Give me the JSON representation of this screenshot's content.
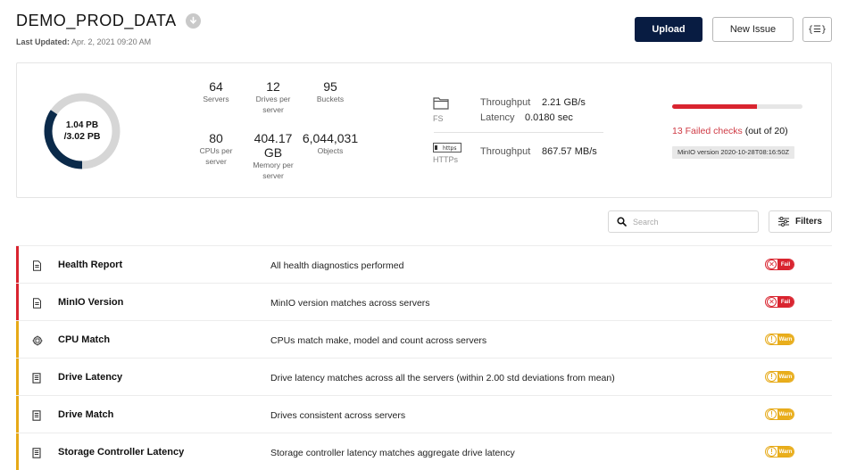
{
  "header": {
    "title": "DEMO_PROD_DATA",
    "last_updated_label": "Last Updated:",
    "last_updated_value": "Apr. 2, 2021 09:20 AM",
    "upload_label": "Upload",
    "new_issue_label": "New Issue",
    "json_label": "{☰}"
  },
  "capacity": {
    "used": "1.04 PB",
    "total": "/3.02 PB",
    "used_fraction": 0.344,
    "used_color": "#0b2a4a",
    "free_color": "#d6d6d6"
  },
  "stats": {
    "servers": {
      "value": "64",
      "label": "Servers"
    },
    "drives_per_server": {
      "value": "12",
      "label1": "Drives per",
      "label2": "server"
    },
    "buckets": {
      "value": "95",
      "label": "Buckets"
    },
    "cpus_per_server": {
      "value": "80",
      "label1": "CPUs per",
      "label2": "server"
    },
    "memory_per_server": {
      "value1": "404.17",
      "value2": "GB",
      "label1": "Memory per",
      "label2": "server"
    },
    "objects": {
      "value": "6,044,031",
      "label": "Objects"
    }
  },
  "performance": {
    "fs_tag": "FS",
    "fs_throughput_label": "Throughput",
    "fs_throughput_value": "2.21 GB/s",
    "fs_latency_label": "Latency",
    "fs_latency_value": "0.0180 sec",
    "https_tag": "HTTPs",
    "https_icon_text": "https",
    "https_throughput_label": "Throughput",
    "https_throughput_value": "867.57 MB/s"
  },
  "checks_summary": {
    "failed_text": "13 Failed checks",
    "out_of_text": "(out of 20)",
    "failed_fraction": 0.65,
    "version": "MinIO version 2020-10-28T08:16:50Z"
  },
  "toolbar": {
    "search_placeholder": "Search",
    "filters_label": "Filters"
  },
  "colors": {
    "fail": "#d9242f",
    "warn": "#e6a917",
    "primary": "#081c42"
  },
  "rows": [
    {
      "icon": "document-icon",
      "name": "Health Report",
      "desc": "All health diagnostics performed",
      "status": "fail",
      "status_label": "Fail"
    },
    {
      "icon": "document-icon",
      "name": "MinIO Version",
      "desc": "MinIO version matches across servers",
      "status": "fail",
      "status_label": "Fail"
    },
    {
      "icon": "cpu-icon",
      "name": "CPU Match",
      "desc": "CPUs match make, model and count across servers",
      "status": "warn",
      "status_label": "Warn"
    },
    {
      "icon": "drive-icon",
      "name": "Drive Latency",
      "desc": "Drive latency matches across all the servers (within 2.00 std deviations from mean)",
      "status": "warn",
      "status_label": "Warn"
    },
    {
      "icon": "drive-icon",
      "name": "Drive Match",
      "desc": "Drives consistent across servers",
      "status": "warn",
      "status_label": "Warn"
    },
    {
      "icon": "drive-icon",
      "name": "Storage Controller Latency",
      "desc": "Storage controller latency matches aggregate drive latency",
      "status": "warn",
      "status_label": "Warn"
    }
  ]
}
